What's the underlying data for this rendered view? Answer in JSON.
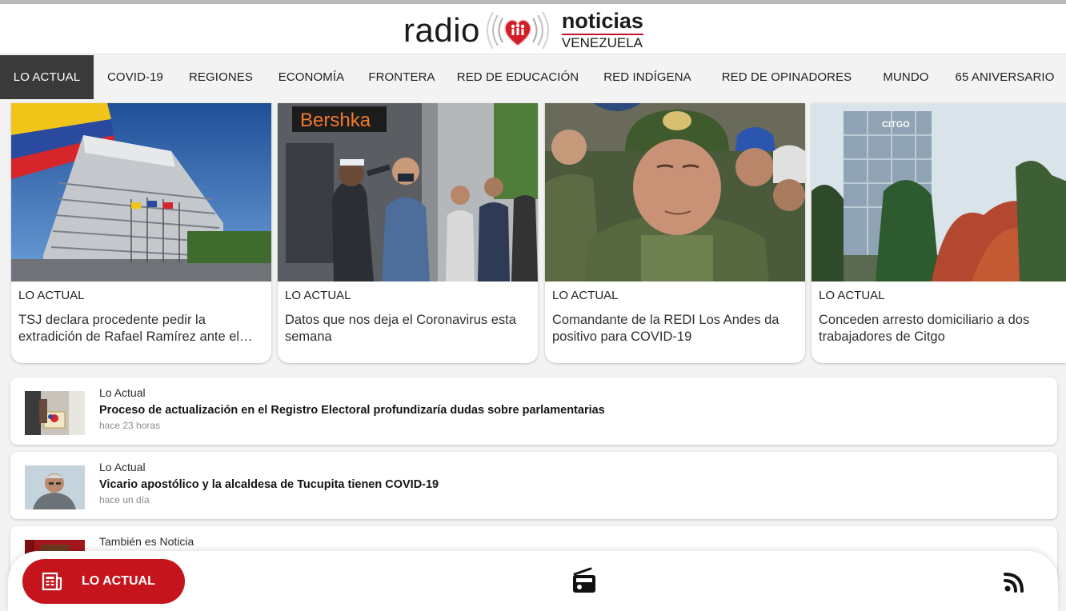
{
  "header": {
    "logo_radio": "radio",
    "logo_noticias": "noticias",
    "logo_country": "VENEZUELA"
  },
  "nav": {
    "items": [
      {
        "label": "LO ACTUAL",
        "active": true
      },
      {
        "label": "COVID-19",
        "active": false
      },
      {
        "label": "REGIONES",
        "active": false
      },
      {
        "label": "ECONOMÍA",
        "active": false
      },
      {
        "label": "FRONTERA",
        "active": false
      },
      {
        "label": "RED DE EDUCACIÓN",
        "active": false
      },
      {
        "label": "RED INDÍGENA",
        "active": false
      },
      {
        "label": "RED DE OPINADORES",
        "active": false
      },
      {
        "label": "MUNDO",
        "active": false
      },
      {
        "label": "65 ANIVERSARIO",
        "active": false
      }
    ]
  },
  "featured": [
    {
      "category": "LO ACTUAL",
      "title": "TSJ declara procedente pedir la extradición de Rafael Ramírez ante el…",
      "image": "government-building-photo"
    },
    {
      "category": "LO ACTUAL",
      "title": "Datos que nos deja el Coronavirus esta semana",
      "image": "temperature-check-photo",
      "image_text": "Bershka"
    },
    {
      "category": "LO ACTUAL",
      "title": "Comandante de la REDI Los Andes da positivo para COVID-19",
      "image": "military-commander-photo"
    },
    {
      "category": "LO ACTUAL",
      "title": "Conceden arresto domiciliario a dos trabajadores de Citgo",
      "image": "citgo-building-photo",
      "image_text": "CITGO"
    }
  ],
  "news_list": [
    {
      "category": "Lo Actual",
      "title": "Proceso de actualización en el Registro Electoral profundizaría dudas sobre parlamentarias",
      "time": "hace 23 horas",
      "image": "electoral-registry-photo"
    },
    {
      "category": "Lo Actual",
      "title": "Vicario apostólico y la alcaldesa de Tucupita tienen COVID-19",
      "time": "hace un día",
      "image": "vicar-portrait-photo"
    },
    {
      "category": "También es Noticia",
      "title": "",
      "time": "",
      "image": "red-carpet-photo"
    }
  ],
  "bottom_nav": {
    "active_label": "LO ACTUAL",
    "active_icon": "newspaper-icon",
    "radio_icon": "radio-icon",
    "rss_icon": "rss-icon"
  },
  "colors": {
    "brand_red": "#c5141c",
    "nav_active_bg": "#3a3a3a",
    "page_bg": "#f3f3f3"
  }
}
